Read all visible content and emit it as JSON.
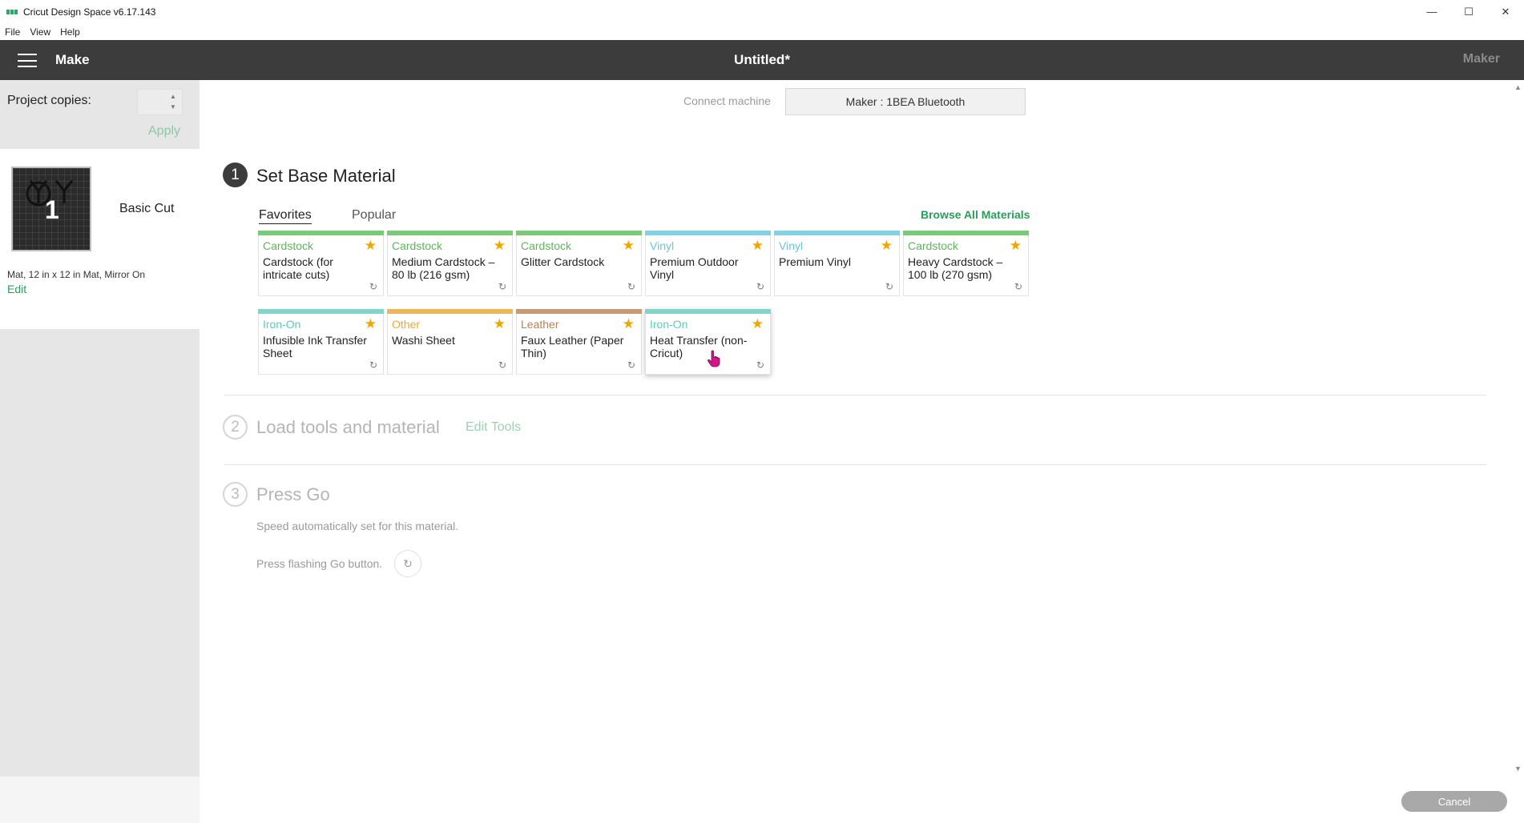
{
  "window": {
    "title": "Cricut Design Space  v6.17.143",
    "minimize": "—",
    "maximize": "☐",
    "close": "✕"
  },
  "menu": [
    "File",
    "View",
    "Help"
  ],
  "header": {
    "section": "Make",
    "title": "Untitled*",
    "machine": "Maker"
  },
  "left": {
    "copies_label": "Project copies:",
    "copies_value": "",
    "apply": "Apply",
    "mat_number": "1",
    "mat_label": "Basic Cut",
    "mat_info": "Mat, 12 in x 12 in Mat, Mirror On",
    "edit": "Edit"
  },
  "connect": {
    "label": "Connect machine",
    "device": "Maker : 1BEA Bluetooth"
  },
  "steps": [
    {
      "number": "1",
      "title": "Set Base Material"
    },
    {
      "number": "2",
      "title": "Load tools and material",
      "action": "Edit Tools"
    },
    {
      "number": "3",
      "title": "Press Go",
      "note1": "Speed automatically set for this material.",
      "note2": "Press flashing Go button."
    }
  ],
  "tabs": {
    "favorites": "Favorites",
    "popular": "Popular",
    "browse_all": "Browse All Materials"
  },
  "colors": {
    "cardstock": "#7dc77a",
    "vinyl": "#86d0e2",
    "iron_on": "#7fd6cb",
    "other": "#f2b45a",
    "leather": "#c99a72",
    "accent_green": "#2a9d59",
    "star": "#f0a600"
  },
  "materials": [
    {
      "category": "Cardstock",
      "name": "Cardstock (for intricate cuts)",
      "color": "#7dc77a",
      "cat_color": "#5fb45b"
    },
    {
      "category": "Cardstock",
      "name": "Medium Cardstock – 80 lb (216 gsm)",
      "color": "#7dc77a",
      "cat_color": "#5fb45b"
    },
    {
      "category": "Cardstock",
      "name": "Glitter Cardstock",
      "color": "#7dc77a",
      "cat_color": "#5fb45b"
    },
    {
      "category": "Vinyl",
      "name": "Premium Outdoor Vinyl",
      "color": "#86d0e2",
      "cat_color": "#6cc4da"
    },
    {
      "category": "Vinyl",
      "name": "Premium Vinyl",
      "color": "#86d0e2",
      "cat_color": "#6cc4da"
    },
    {
      "category": "Cardstock",
      "name": "Heavy Cardstock – 100 lb (270 gsm)",
      "color": "#7dc77a",
      "cat_color": "#5fb45b"
    },
    {
      "category": "Iron-On",
      "name": "Infusible Ink Transfer Sheet",
      "color": "#7fd6cb",
      "cat_color": "#5fcabc"
    },
    {
      "category": "Other",
      "name": "Washi Sheet",
      "color": "#f2b45a",
      "cat_color": "#f0a640"
    },
    {
      "category": "Leather",
      "name": "Faux Leather (Paper Thin)",
      "color": "#c99a72",
      "cat_color": "#b58357"
    },
    {
      "category": "Iron-On",
      "name": "Heat Transfer (non-Cricut)",
      "color": "#7fd6cb",
      "cat_color": "#5fcabc"
    }
  ],
  "footer": {
    "cancel": "Cancel"
  }
}
